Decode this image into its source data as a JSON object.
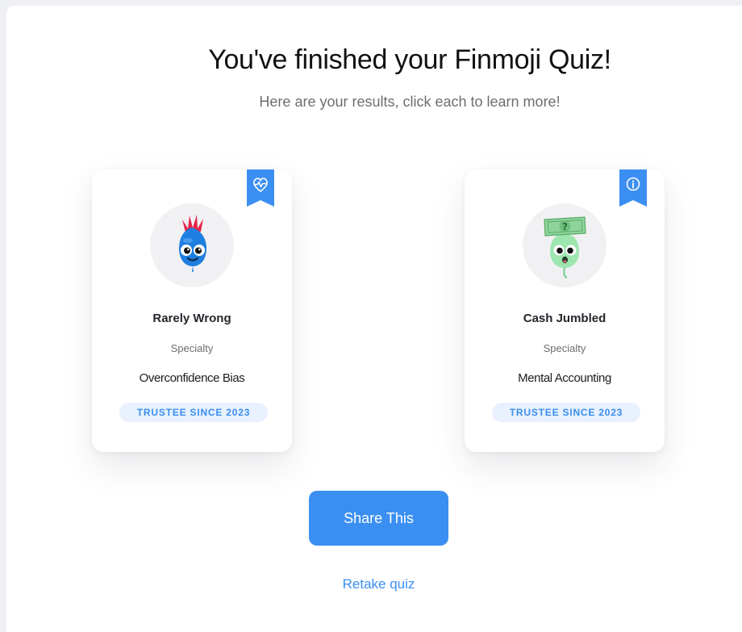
{
  "header": {
    "title": "You've finished your Finmoji Quiz!",
    "subtitle": "Here are your results, click each to learn more!"
  },
  "results": [
    {
      "name": "Rarely Wrong",
      "specialty_label": "Specialty",
      "specialty": "Overconfidence Bias",
      "badge": "TRUSTEE SINCE 2023",
      "ribbon_icon": "heartbeat-icon",
      "avatar": "blue-drop-mohawk-character"
    },
    {
      "name": "Cash Jumbled",
      "specialty_label": "Specialty",
      "specialty": "Mental Accounting",
      "badge": "TRUSTEE SINCE 2023",
      "ribbon_icon": "info-icon",
      "avatar": "green-drop-money-character"
    }
  ],
  "actions": {
    "share_label": "Share This",
    "retake_label": "Retake quiz"
  },
  "colors": {
    "accent": "#3b8ff2",
    "badge_bg": "#e8f1fd",
    "page_bg": "#eef0f3"
  }
}
